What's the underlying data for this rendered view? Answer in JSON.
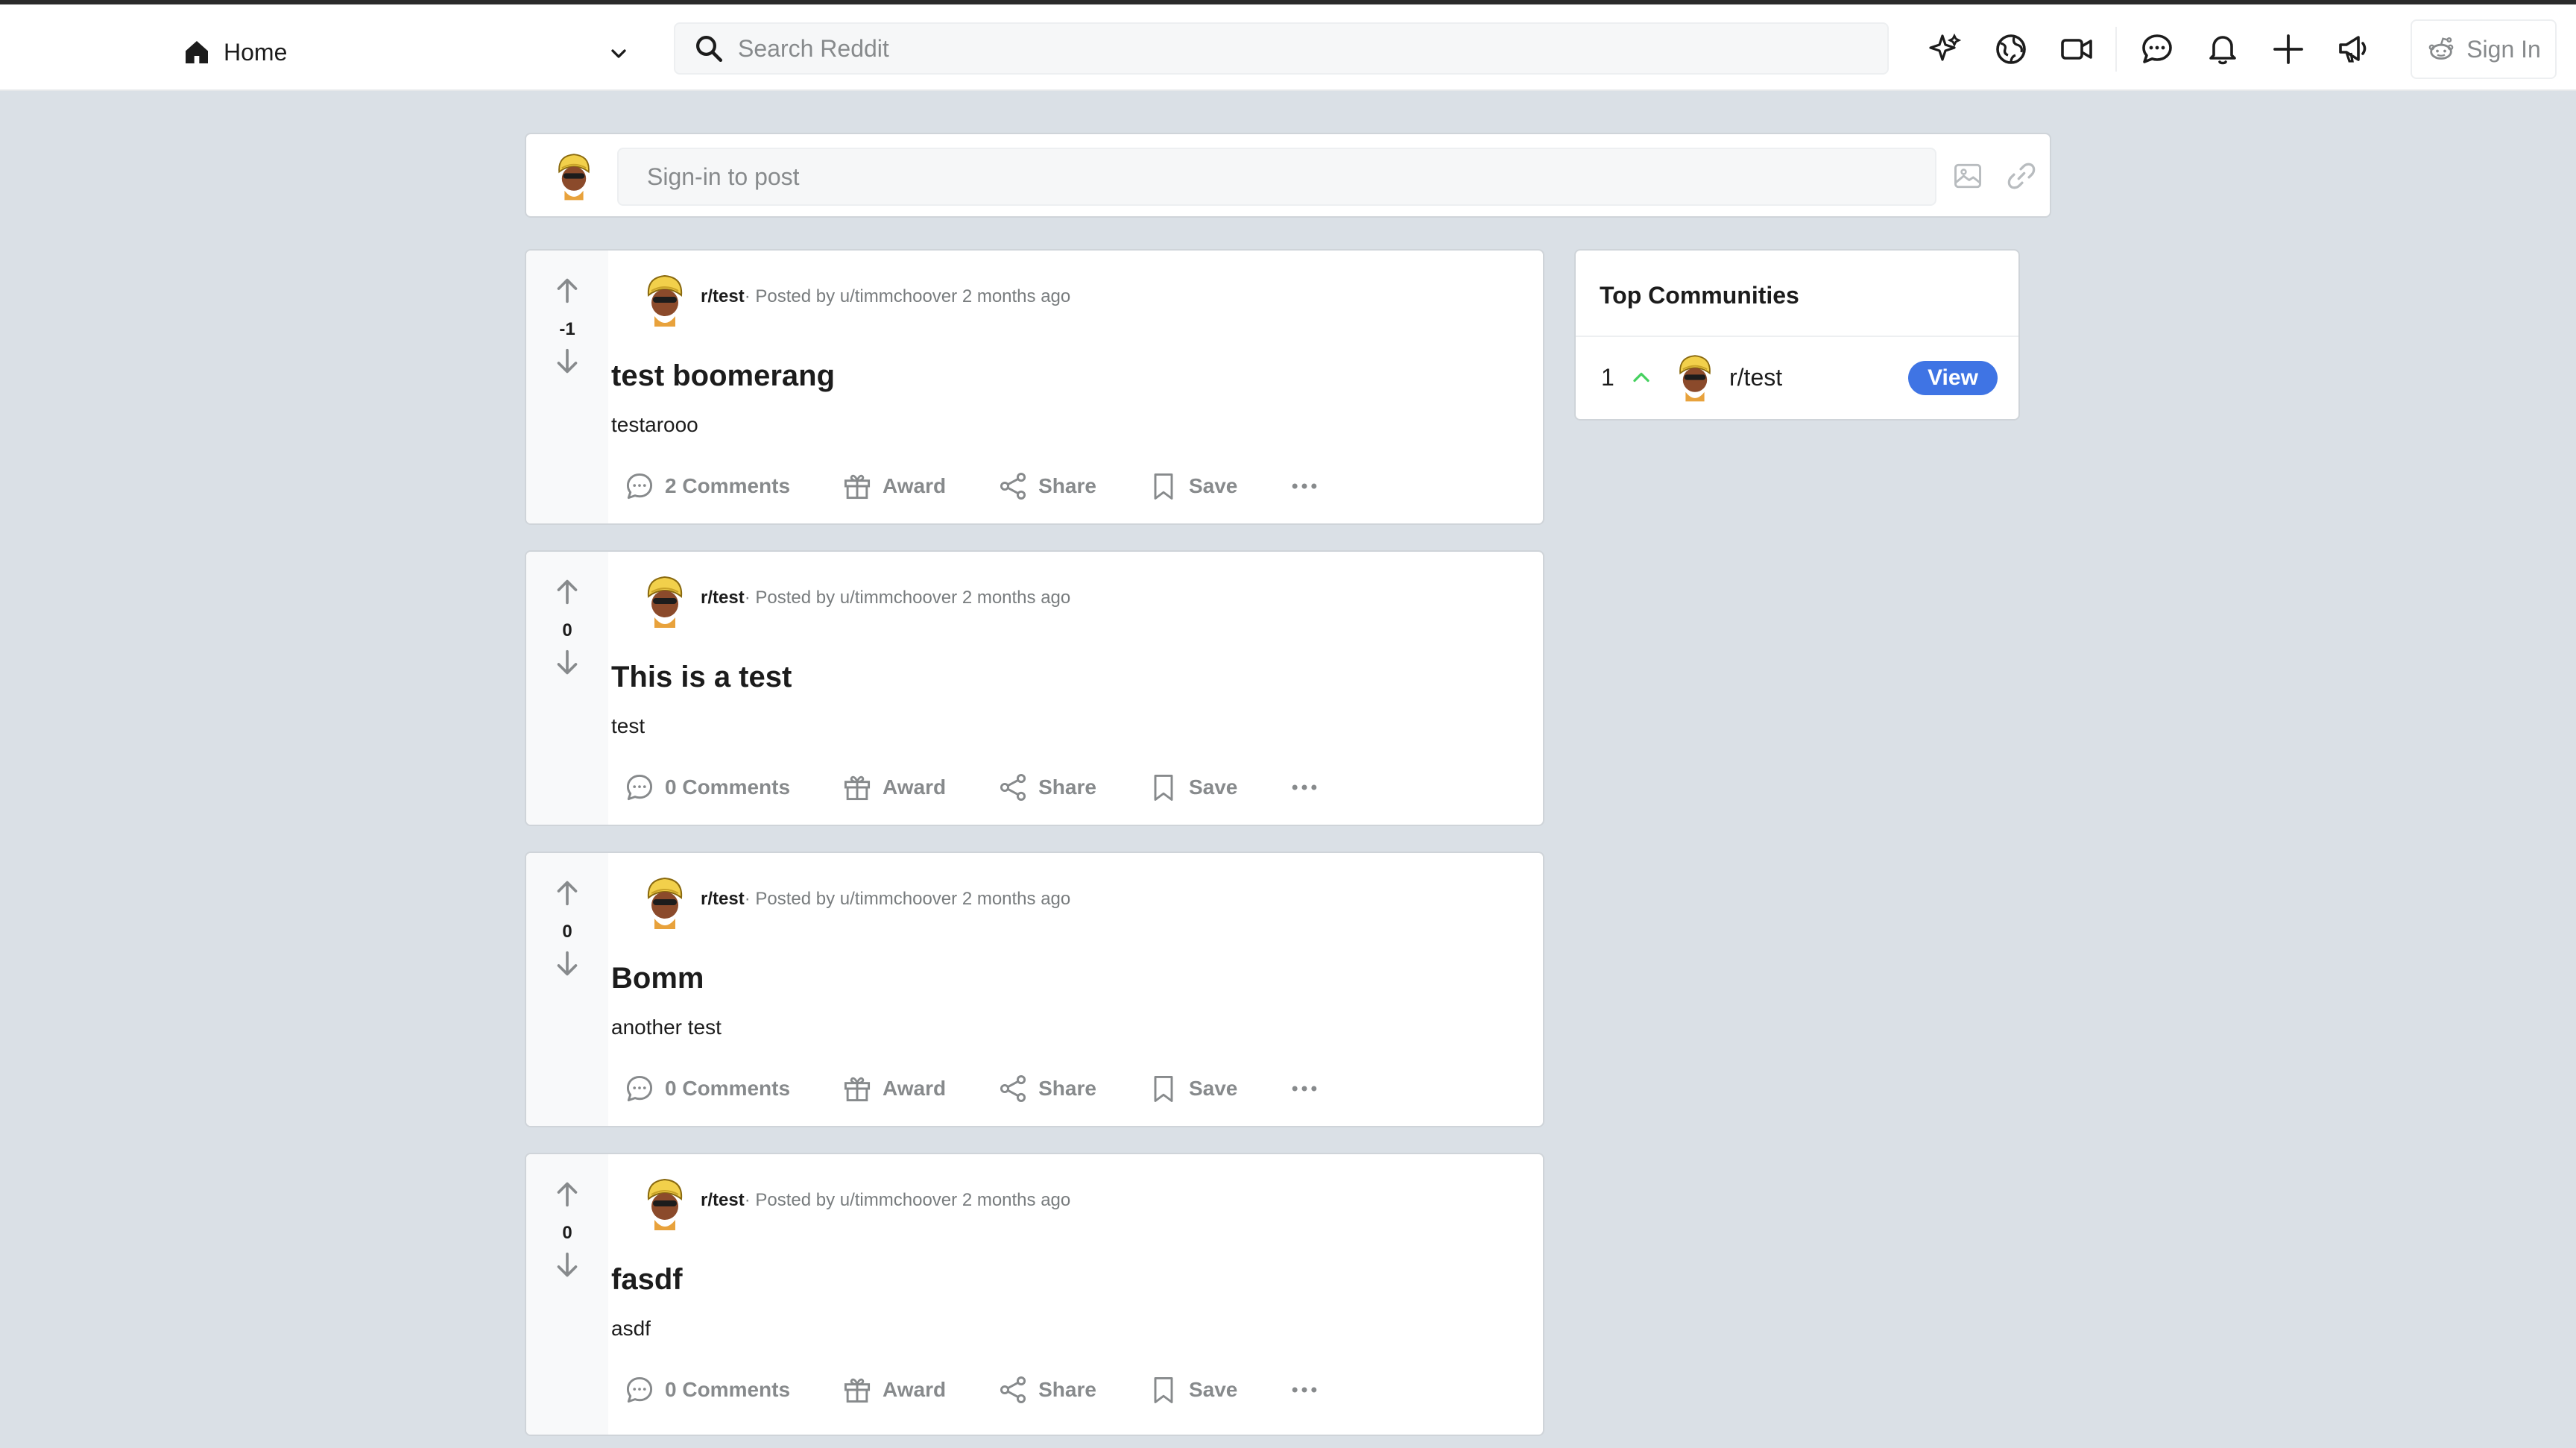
{
  "header": {
    "home_label": "Home",
    "search_placeholder": "Search Reddit",
    "icons": [
      "sparkle-icon",
      "globe-icon",
      "video-icon",
      "chat-icon",
      "bell-icon",
      "plus-icon",
      "megaphone-icon"
    ],
    "sign_in_label": "Sign In"
  },
  "composer": {
    "placeholder": "Sign-in to post"
  },
  "posts": [
    {
      "subreddit": "r/test",
      "posted_by": "· Posted by ",
      "user": "u/timmchoover",
      "time": "2 months ago",
      "score": "-1",
      "title": "test boomerang",
      "body": "testarooo",
      "comments": "2 Comments",
      "award": "Award",
      "share": "Share",
      "save": "Save"
    },
    {
      "subreddit": "r/test",
      "posted_by": "· Posted by ",
      "user": "u/timmchoover",
      "time": "2 months ago",
      "score": "0",
      "title": "This is a test",
      "body": "test",
      "comments": "0 Comments",
      "award": "Award",
      "share": "Share",
      "save": "Save"
    },
    {
      "subreddit": "r/test",
      "posted_by": "· Posted by ",
      "user": "u/timmchoover",
      "time": "2 months ago",
      "score": "0",
      "title": "Bomm",
      "body": "another test",
      "comments": "0 Comments",
      "award": "Award",
      "share": "Share",
      "save": "Save"
    },
    {
      "subreddit": "r/test",
      "posted_by": "· Posted by ",
      "user": "u/timmchoover",
      "time": "2 months ago",
      "score": "0",
      "title": "fasdf",
      "body": "asdf",
      "comments": "0 Comments",
      "award": "Award",
      "share": "Share",
      "save": "Save"
    }
  ],
  "sidebar": {
    "title": "Top Communities",
    "communities": [
      {
        "rank": "1",
        "name": "r/test",
        "view_label": "View"
      }
    ]
  },
  "colors": {
    "page_bg": "#dae0e6",
    "card_bg": "#ffffff",
    "muted_text": "#878a8c",
    "accent_blue": "#3f74e4",
    "rank_up_green": "#46d160"
  }
}
